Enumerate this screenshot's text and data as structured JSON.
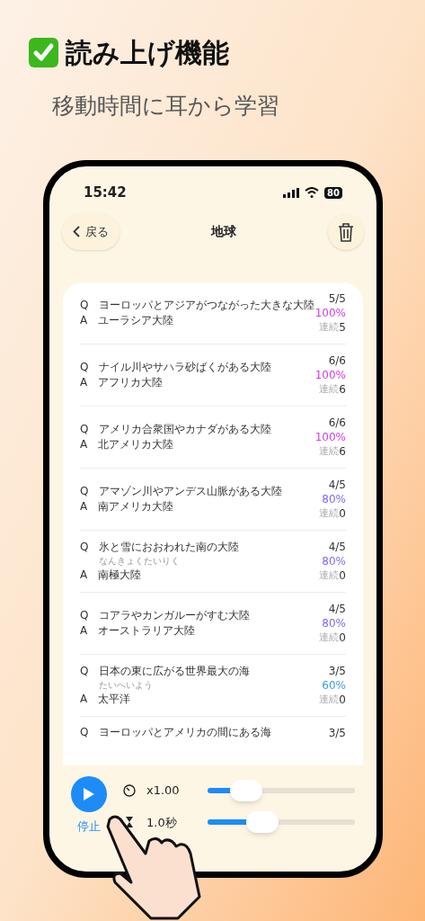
{
  "headline": "読み上げ機能",
  "subtitle": "移動時間に耳から学習",
  "status_bar": {
    "time": "15:42",
    "battery": "80"
  },
  "nav": {
    "back": "戻る",
    "title": "地球"
  },
  "items": [
    {
      "q_label": "Q",
      "question": "ヨーロッパとアジアがつながった大きな大陸",
      "a_label": "A",
      "answer": "ユーラシア大陸",
      "score": "5/5",
      "percent": "100%",
      "color": "#d03ee0",
      "streak_label": "連続",
      "streak": "5"
    },
    {
      "q_label": "Q",
      "question": "ナイル川やサハラ砂ばくがある大陸",
      "a_label": "A",
      "answer": "アフリカ大陸",
      "score": "6/6",
      "percent": "100%",
      "color": "#d03ee0",
      "streak_label": "連続",
      "streak": "6"
    },
    {
      "q_label": "Q",
      "question": "アメリカ合衆国やカナダがある大陸",
      "a_label": "A",
      "answer": "北アメリカ大陸",
      "score": "6/6",
      "percent": "100%",
      "color": "#d03ee0",
      "streak_label": "連続",
      "streak": "6"
    },
    {
      "q_label": "Q",
      "question": "アマゾン川やアンデス山脈がある大陸",
      "a_label": "A",
      "answer": "南アメリカ大陸",
      "score": "4/5",
      "percent": "80%",
      "color": "#7a6cf0",
      "streak_label": "連続",
      "streak": "0"
    },
    {
      "q_label": "Q",
      "question": "氷と雪におおわれた南の大陸",
      "reading": "なんきょくたいりく",
      "a_label": "A",
      "answer": "南極大陸",
      "score": "4/5",
      "percent": "80%",
      "color": "#7a6cf0",
      "streak_label": "連続",
      "streak": "0"
    },
    {
      "q_label": "Q",
      "question": "コアラやカンガルーがすむ大陸",
      "a_label": "A",
      "answer": "オーストラリア大陸",
      "score": "4/5",
      "percent": "80%",
      "color": "#7a6cf0",
      "streak_label": "連続",
      "streak": "0"
    },
    {
      "q_label": "Q",
      "question": "日本の東に広がる世界最大の海",
      "reading": "たいへいよう",
      "a_label": "A",
      "answer": "太平洋",
      "score": "3/5",
      "percent": "60%",
      "color": "#3d9af0",
      "streak_label": "連続",
      "streak": "0"
    },
    {
      "q_label": "Q",
      "question": "ヨーロッパとアメリカの間にある海",
      "score": "3/5"
    }
  ],
  "player": {
    "stop_label": "停止",
    "speed": {
      "reading": "x1.00",
      "level": 0.26
    },
    "interval": {
      "reading": "1.0秒",
      "level": 0.37
    }
  }
}
